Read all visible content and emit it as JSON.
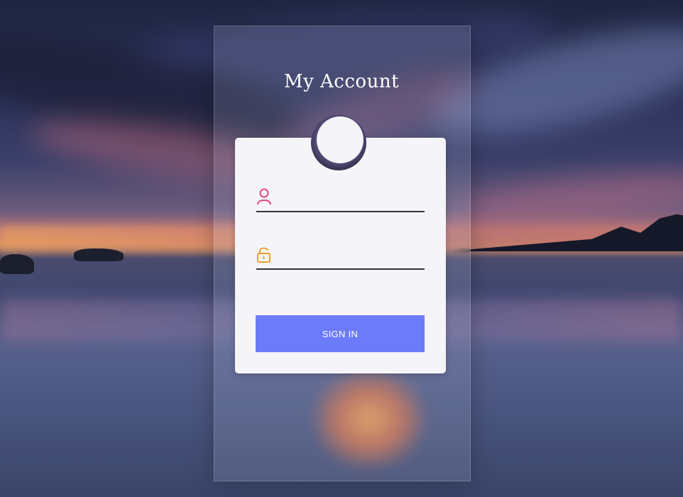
{
  "page": {
    "title": "My Account"
  },
  "form": {
    "username": {
      "value": "",
      "placeholder": "",
      "icon": "user-icon",
      "icon_color": "#e8437e"
    },
    "password": {
      "value": "",
      "placeholder": "",
      "icon": "unlock-icon",
      "icon_color": "#f0a030"
    },
    "signin_label": "SIGN IN",
    "signin_color": "#6b7bfa"
  }
}
